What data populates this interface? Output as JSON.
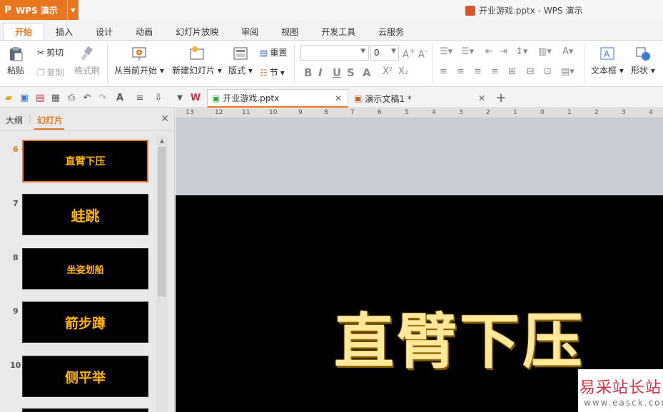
{
  "app": {
    "name": "WPS 演示",
    "window_title": "开业游戏.pptx - WPS 演示"
  },
  "ribbon_tabs": [
    "开始",
    "插入",
    "设计",
    "动画",
    "幻灯片放映",
    "审阅",
    "视图",
    "开发工具",
    "云服务"
  ],
  "ribbon": {
    "paste": "粘贴",
    "cut": "剪切",
    "copy": "复制",
    "format_painter": "格式刷",
    "play_from_current": "从当前开始",
    "new_slide": "新建幻灯片",
    "layout": "版式",
    "reset": "重置",
    "section": "节",
    "font_size": "0",
    "text_box": "文本框",
    "shape": "形状"
  },
  "doc_tabs": [
    {
      "label": "开业游戏.pptx",
      "active": true
    },
    {
      "label": "演示文稿1 *",
      "active": false
    }
  ],
  "left_panel": {
    "tab_outline": "大纲",
    "tab_slides": "幻灯片",
    "slides": [
      {
        "num": "6",
        "title": "直臂下压",
        "active": true
      },
      {
        "num": "7",
        "title": "蛙跳",
        "active": false
      },
      {
        "num": "8",
        "title": "坐姿划船",
        "active": false
      },
      {
        "num": "9",
        "title": "箭步蹲",
        "active": false
      },
      {
        "num": "10",
        "title": "侧平举",
        "active": false
      }
    ]
  },
  "ruler_labels": [
    "13",
    "12",
    "11",
    "10",
    "9",
    "8",
    "7",
    "6",
    "5",
    "4",
    "3",
    "2",
    "1",
    "0",
    "1",
    "2",
    "3",
    "4"
  ],
  "slide": {
    "title": "直臂下压"
  },
  "watermark": {
    "text": "易采站长站",
    "url": "www.easck.com"
  },
  "colors": {
    "accent": "#e8761e",
    "slide_text": "#ffe89a",
    "thumb_text": "#ffb400"
  }
}
